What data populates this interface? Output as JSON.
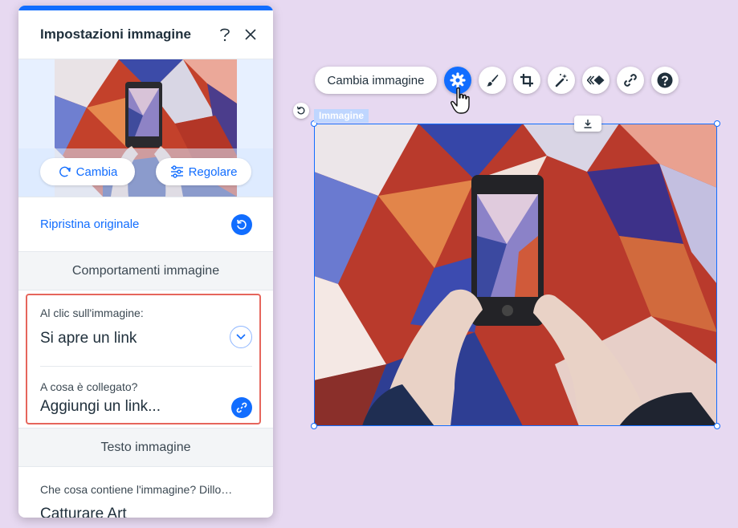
{
  "panel": {
    "title": "Impostazioni immagine",
    "help_icon": "question-mark-icon",
    "close_icon": "close-icon",
    "change_label": "Cambia",
    "adjust_label": "Regolare",
    "restore_label": "Ripristina originale",
    "behaviors_header": "Comportamenti immagine",
    "click_label": "Al clic sull'immagine:",
    "click_value": "Si apre un link",
    "link_label": "A cosa è collegato?",
    "link_value": "Aggiungi un link...",
    "alt_header": "Testo immagine",
    "alt_label": "Che cosa contiene l'immagine? Dillo…",
    "alt_value": "Catturare Art"
  },
  "canvas": {
    "change_image_label": "Cambia immagine",
    "element_tag": "Immagine",
    "toolbar_icons": [
      "settings-gear-icon",
      "brush-icon",
      "crop-icon",
      "magic-wand-icon",
      "animation-icon",
      "link-icon",
      "help-icon"
    ]
  },
  "colors": {
    "accent": "#116DFF",
    "highlight": "#E6665C",
    "background": "#E7D9F1"
  }
}
